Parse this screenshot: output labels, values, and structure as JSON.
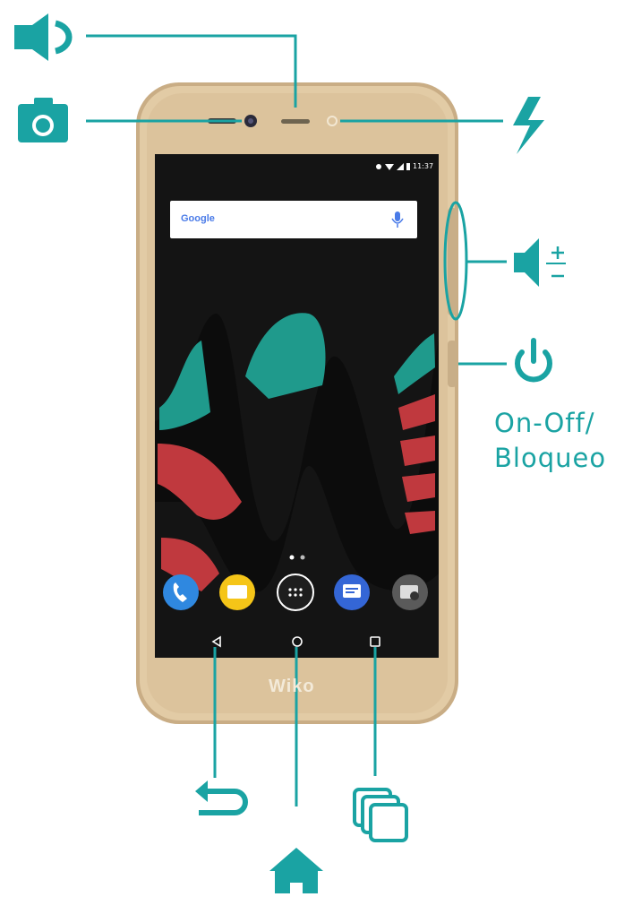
{
  "labels": {
    "power_line1": "On-Off/",
    "power_line2": "Bloqueo"
  },
  "phone": {
    "search_brand": "Google",
    "status_time": "11:37",
    "logo_text": "Wiko"
  },
  "icons": {
    "earpiece": "speaker-icon",
    "front_camera": "camera-icon",
    "flash": "flash-icon",
    "volume": "volume-icon",
    "power": "power-icon",
    "back": "back-icon",
    "home": "home-icon",
    "recents": "recent-apps-icon"
  },
  "colors": {
    "accent": "#1aa3a3",
    "phone_gold": "#dcc39c",
    "screen": "#141414",
    "w_red": "#c0393e",
    "w_teal": "#1f9a8c"
  }
}
